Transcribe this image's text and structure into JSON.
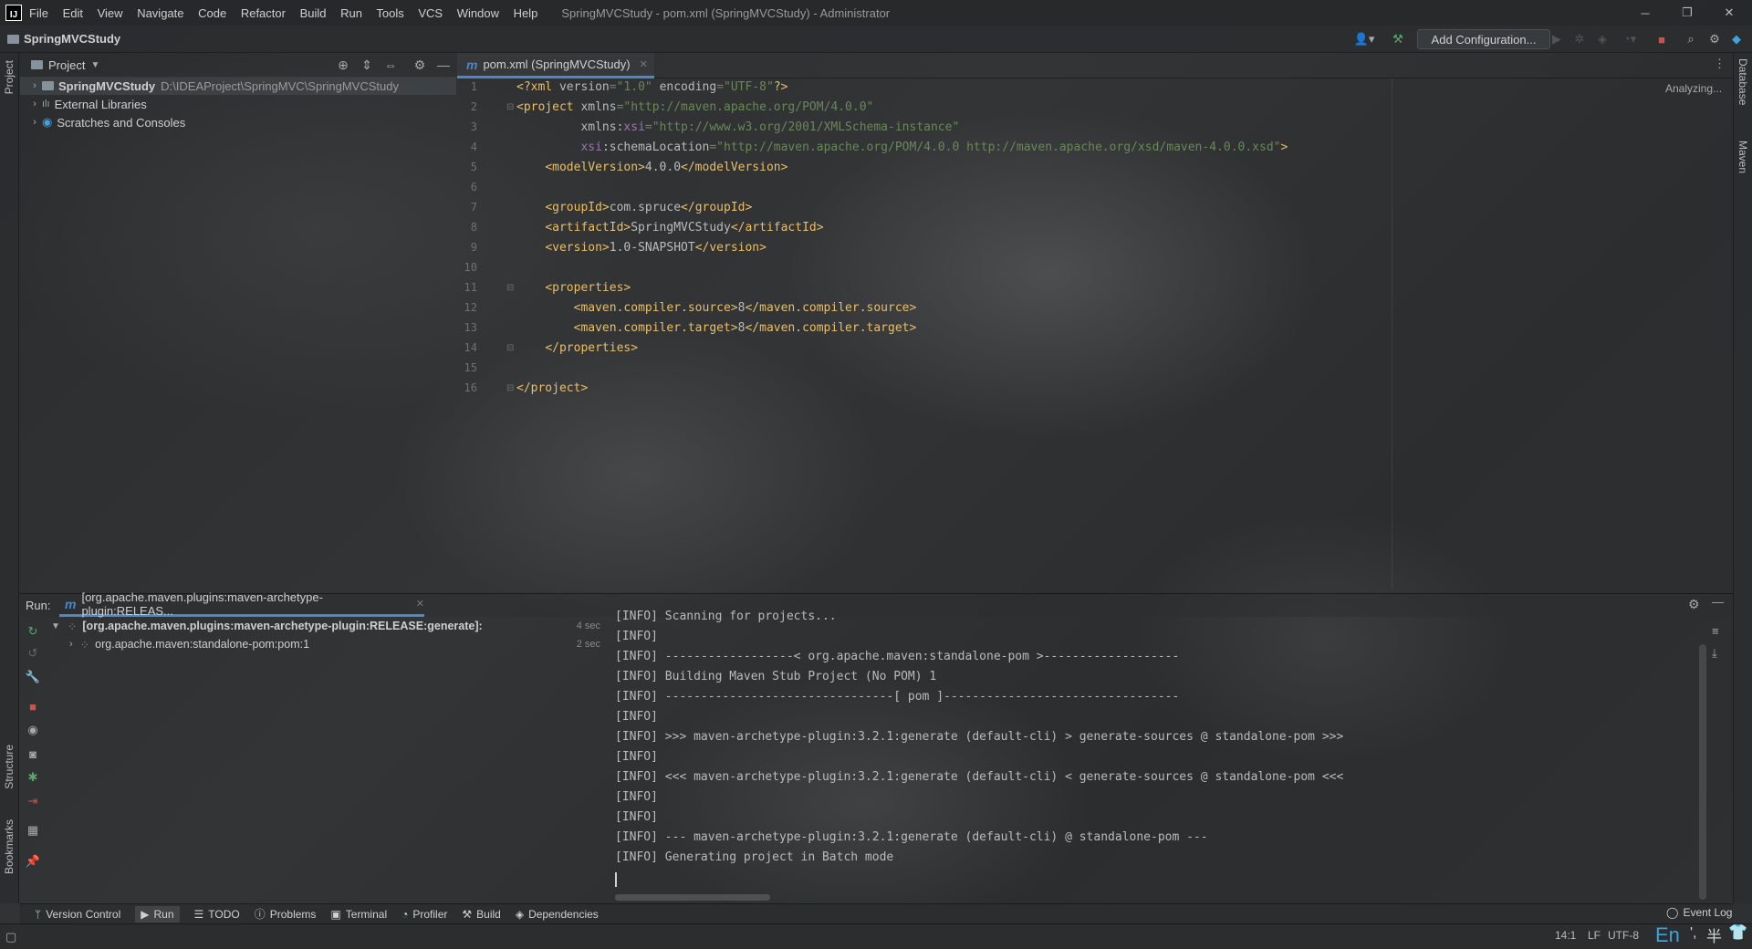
{
  "window": {
    "logo": "IJ",
    "menu": [
      "File",
      "Edit",
      "View",
      "Navigate",
      "Code",
      "Refactor",
      "Build",
      "Run",
      "Tools",
      "VCS",
      "Window",
      "Help"
    ],
    "title": "SpringMVCStudy - pom.xml (SpringMVCStudy) - Administrator"
  },
  "navbar": {
    "project": "SpringMVCStudy",
    "add_configuration": "Add Configuration..."
  },
  "left_strip": {
    "project": "Project",
    "structure": "Structure",
    "bookmarks": "Bookmarks"
  },
  "right_strip": {
    "database": "Database",
    "maven": "Maven"
  },
  "project_panel": {
    "title": "Project",
    "items": [
      {
        "name": "SpringMVCStudy",
        "path": "D:\\IDEAProject\\SpringMVC\\SpringMVCStudy"
      },
      {
        "name": "External Libraries",
        "path": ""
      },
      {
        "name": "Scratches and Consoles",
        "path": ""
      }
    ]
  },
  "editor": {
    "tab": "pom.xml (SpringMVCStudy)",
    "status": "Analyzing...",
    "line_numbers": [
      "1",
      "2",
      "3",
      "4",
      "5",
      "6",
      "7",
      "8",
      "9",
      "10",
      "11",
      "12",
      "13",
      "14",
      "15",
      "16"
    ]
  },
  "run_panel": {
    "label": "Run:",
    "tab": "[org.apache.maven.plugins:maven-archetype-plugin:RELEAS...",
    "tree": [
      {
        "label": "[org.apache.maven.plugins:maven-archetype-plugin:RELEASE:generate]:",
        "time": "4 sec"
      },
      {
        "label": "org.apache.maven:standalone-pom:pom:1",
        "time": "2 sec"
      }
    ],
    "console": [
      "[INFO] Scanning for projects...",
      "[INFO]",
      "[INFO] ------------------< org.apache.maven:standalone-pom >-------------------",
      "[INFO] Building Maven Stub Project (No POM) 1",
      "[INFO] --------------------------------[ pom ]---------------------------------",
      "[INFO]",
      "[INFO] >>> maven-archetype-plugin:3.2.1:generate (default-cli) > generate-sources @ standalone-pom >>>",
      "[INFO]",
      "[INFO] <<< maven-archetype-plugin:3.2.1:generate (default-cli) < generate-sources @ standalone-pom <<<",
      "[INFO]",
      "[INFO]",
      "[INFO] --- maven-archetype-plugin:3.2.1:generate (default-cli) @ standalone-pom ---",
      "[INFO] Generating project in Batch mode"
    ]
  },
  "bottom_tools": {
    "version_control": "Version Control",
    "run": "Run",
    "todo": "TODO",
    "problems": "Problems",
    "terminal": "Terminal",
    "profiler": "Profiler",
    "build": "Build",
    "dependencies": "Dependencies",
    "event_log": "Event Log"
  },
  "status": {
    "position": "14:1",
    "line_sep": "LF",
    "encoding": "UTF-8",
    "ime": "En"
  },
  "colors": {
    "accent": "#4a88c7",
    "tag": "#e8bf6a",
    "string": "#6a8759",
    "namespace": "#9876aa",
    "stop": "#c75450",
    "run": "#59a869"
  }
}
